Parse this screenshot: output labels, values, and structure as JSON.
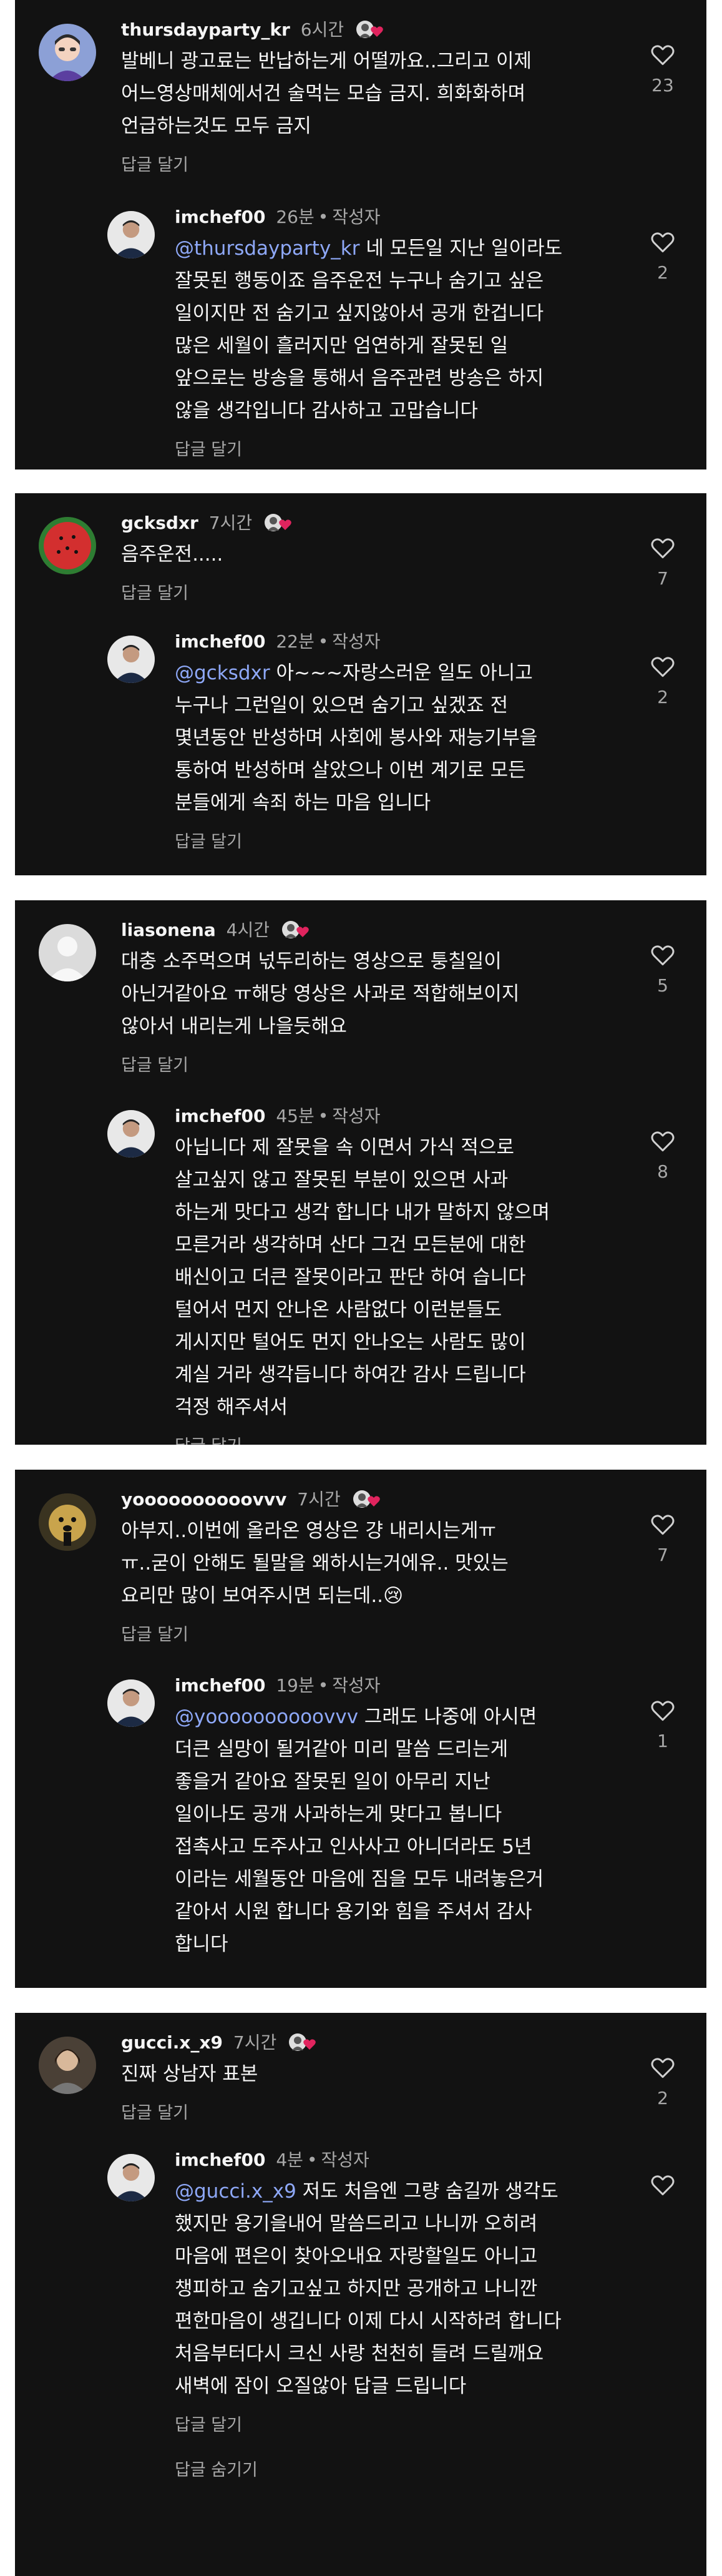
{
  "threads": [
    {
      "comment": {
        "user": "thursdayparty_kr",
        "time": "6시간",
        "lines": [
          "발베니 광고료는 반납하는게 어떨까요..그리고 이제",
          "어느영상매체에서건 술먹는 모습 금지. 희화화하며",
          "언급하는것도 모두 금지"
        ],
        "likes": "23",
        "reply_label": "답글 달기"
      },
      "reply": {
        "user": "imchef00",
        "time": "26분",
        "author_tag": "작성자",
        "mention": "@thursdayparty_kr",
        "lines": [
          " 네 모든일 지난 일이라도",
          "잘못된 행동이죠  음주운전 누구나 숨기고 싶은",
          "일이지만 전 숨기고 싶지않아서 공개 한겁니다",
          "많은 세월이  흘러지만 엄연하게 잘못된 일",
          "앞으로는 방송을 통해서 음주관련 방송은 하지",
          "않을 생각입니다 감사하고 고맙습니다"
        ],
        "likes": "2",
        "reply_label": "답글 달기"
      }
    },
    {
      "comment": {
        "user": "gcksdxr",
        "time": "7시간",
        "lines": [
          "음주운전....."
        ],
        "likes": "7",
        "reply_label": "답글 달기"
      },
      "reply": {
        "user": "imchef00",
        "time": "22분",
        "author_tag": "작성자",
        "mention": "@gcksdxr",
        "lines": [
          " 아~~~자랑스러운 일도 아니고",
          "누구나 그런일이 있으면 숨기고 싶겠죠 전",
          "몇년동안 반성하며 사회에 봉사와 재능기부을",
          "통하여 반성하며 살았으나 이번 계기로 모든",
          "분들에게 속죄 하는 마음 입니다"
        ],
        "likes": "2",
        "reply_label": "답글 달기"
      }
    },
    {
      "comment": {
        "user": "liasonena",
        "time": "4시간",
        "lines": [
          "대충 소주먹으며 넋두리하는 영상으로 퉁칠일이",
          "아닌거같아요 ㅠ해당 영상은 사과로 적합해보이지",
          "않아서 내리는게 나을듯해요"
        ],
        "likes": "5",
        "reply_label": "답글 달기"
      },
      "reply": {
        "user": "imchef00",
        "time": "45분",
        "author_tag": "작성자",
        "mention": "",
        "lines": [
          "아닙니다 제 잘못을 속 이면서 가식 적으로",
          "살고싶지 않고 잘못된 부분이 있으면 사과",
          "하는게 맛다고 생각 합니다 내가 말하지 않으며",
          "모른거라 생각하며 산다  그건 모든분에  대한",
          "배신이고  더큰 잘못이라고 판단 하여 습니다",
          "털어서 먼지 안나온  사람없다  이런분들도",
          "게시지만  털어도 먼지 안나오는 사람도 많이",
          "계실 거라 생각듭니다  하여간 감사 드립니다",
          "걱정 해주셔서"
        ],
        "likes": "8",
        "reply_label": "답글 달기"
      }
    },
    {
      "comment": {
        "user": "yoooooooooovvv",
        "time": "7시간",
        "lines": [
          "아부지..이번에 올라온 영상은 걍 내리시는게ㅠ",
          "ㅠ..굳이 안해도 될말을 왜하시는거에유.. 맛있는",
          "요리만 많이 보여주시면 되는데..😢"
        ],
        "likes": "7",
        "reply_label": "답글 달기"
      },
      "reply": {
        "user": "imchef00",
        "time": "19분",
        "author_tag": "작성자",
        "mention": "@yoooooooooovvv",
        "lines": [
          " 그래도 나중에 아시면",
          "더큰 실망이 될거같아 미리 말씀 드리는게",
          "좋을거 같아요 잘못된 일이 아무리 지난",
          "일이나도 공개 사과하는게 맞다고 봅니다",
          "접촉사고 도주사고 인사사고 아니더라도 5년",
          "이라는 세월동안 마음에 짐을 모두 내려놓은거",
          "같아서 시원 합니다 용기와 힘을 주셔서 감사",
          "합니다"
        ],
        "likes": "1",
        "reply_label": ""
      }
    },
    {
      "comment": {
        "user": "gucci.x_x9",
        "time": "7시간",
        "lines": [
          "진짜 상남자 표본"
        ],
        "likes": "2",
        "reply_label": "답글 달기"
      },
      "reply": {
        "user": "imchef00",
        "time": "4분",
        "author_tag": "작성자",
        "mention": "@gucci.x_x9",
        "lines": [
          " 저도 처음엔 그량 숨길까 생각도",
          "했지만 용기을내어 말씀드리고 나니까 오히려",
          "마음에 편은이 찾아오내요  자랑할일도 아니고",
          "챙피하고 숨기고싶고  하지만 공개하고 나니깐",
          "편한마음이 생깁니다 이제 다시 시작하려 합니다",
          "처음부터다시  크신 사랑 천천히 들려 드릴깨요",
          "새벽에 잠이 오질않아 답글 드립니다"
        ],
        "likes": "",
        "reply_label": "답글 달기"
      },
      "hide_label": "답글 숨기기"
    }
  ],
  "colors": {
    "card_bg": "#121212",
    "mention": "#8ea8f7",
    "muted": "#a8a8a8",
    "like_heart": "#e0245e"
  }
}
